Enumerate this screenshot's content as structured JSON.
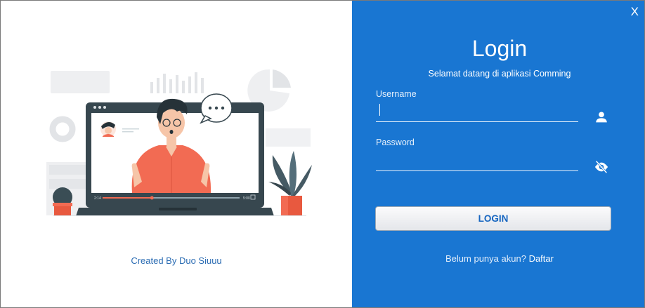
{
  "window": {
    "close_label": "X"
  },
  "left_panel": {
    "credit": "Created By Duo Siuuu",
    "illustration": {
      "icon": "video-call-illustration",
      "video_time_left": "2:14",
      "video_time_right": "5:00",
      "progress": 0.36
    }
  },
  "login": {
    "title": "Login",
    "subtitle": "Selamat datang di aplikasi Comming",
    "username_label": "Username",
    "username_value": "",
    "password_label": "Password",
    "password_value": "",
    "user_icon": "user-icon",
    "visibility_icon": "eye-off-icon",
    "button_label": "LOGIN",
    "signup_prompt": "Belum punya akun?",
    "signup_link": "Daftar"
  },
  "colors": {
    "accent": "#1976d2",
    "credit_text": "#2b6cb3",
    "shirt": "#f26b53",
    "laptop": "#37474f"
  }
}
